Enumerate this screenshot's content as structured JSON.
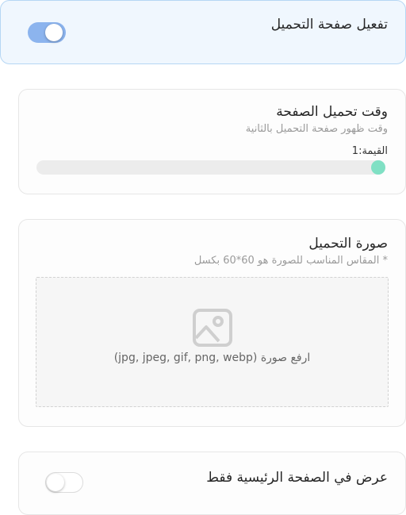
{
  "loading_page": {
    "toggle_label": "تفعيل صفحة التحميل",
    "enabled": true
  },
  "loading_time": {
    "title": "وقت تحميل الصفحة",
    "subtitle": "وقت ظهور صفحة التحميل بالثانية",
    "value_label": "القيمة:1",
    "value": 1,
    "max": 1
  },
  "loading_image": {
    "title": "صورة التحميل",
    "subtitle": "* المقاس المناسب للصورة هو 60*60 بكسل",
    "upload_text": "ارفع صورة (jpg, jpeg, gif, png, webp)",
    "icon": "image-icon"
  },
  "homepage_only": {
    "toggle_label": "عرض في الصفحة الرئيسية فقط",
    "enabled": false
  },
  "colors": {
    "toggle_on": "#8cb4ee",
    "slider_thumb": "#80e0c4",
    "active_card_bg": "#f0f7fe",
    "active_card_border": "#b6d7f4"
  }
}
